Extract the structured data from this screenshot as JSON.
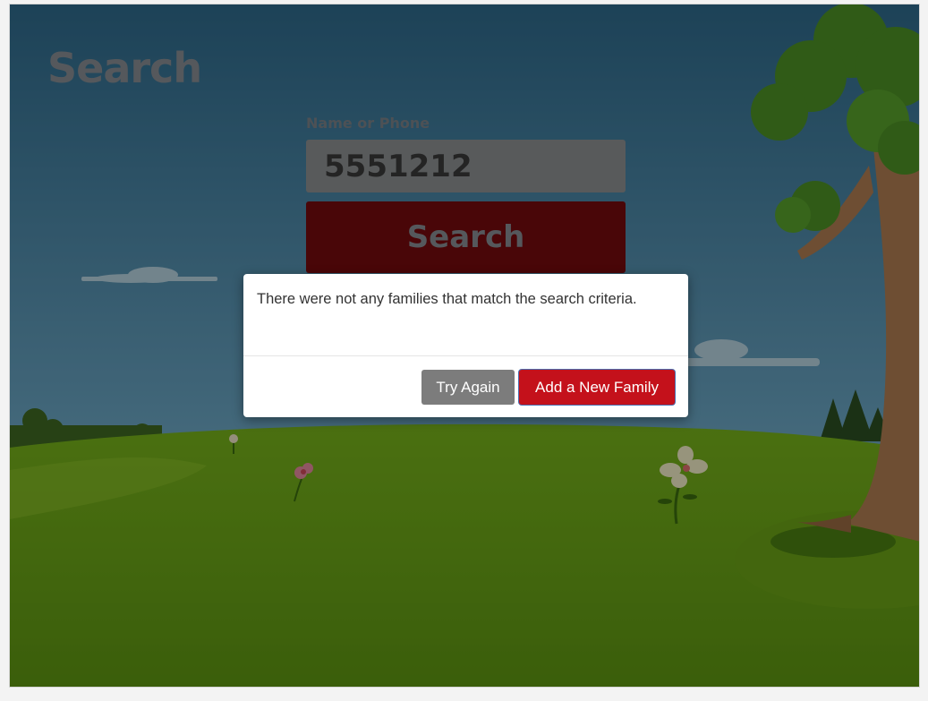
{
  "page": {
    "title": "Search"
  },
  "search": {
    "label": "Name or Phone",
    "value": "5551212",
    "button_label": "Search"
  },
  "dialog": {
    "message": "There were not any families that match the search criteria.",
    "try_again_label": "Try Again",
    "add_family_label": "Add a New Family"
  },
  "colors": {
    "primary_red": "#c4111b",
    "secondary_gray": "#7c7c7c",
    "sky_top": "#2f6b8d",
    "grass": "#4c7f0f"
  }
}
